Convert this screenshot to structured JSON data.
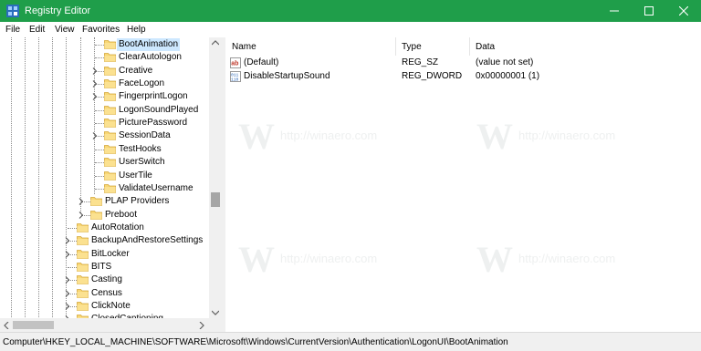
{
  "window": {
    "title": "Registry Editor",
    "accent": "#1f9e4a",
    "controls": [
      "minimize-icon",
      "maximize-icon",
      "close-icon"
    ]
  },
  "menu": [
    "File",
    "Edit",
    "View",
    "Favorites",
    "Help"
  ],
  "tree": {
    "items": [
      {
        "label": "BootAnimation",
        "selected": true
      },
      {
        "label": "ClearAutologon"
      },
      {
        "label": "Creative",
        "expandable": true
      },
      {
        "label": "FaceLogon",
        "expandable": true
      },
      {
        "label": "FingerprintLogon",
        "expandable": true
      },
      {
        "label": "LogonSoundPlayed"
      },
      {
        "label": "PicturePassword"
      },
      {
        "label": "SessionData",
        "expandable": true
      },
      {
        "label": "TestHooks"
      },
      {
        "label": "UserSwitch"
      },
      {
        "label": "UserTile"
      },
      {
        "label": "ValidateUsername"
      },
      {
        "label": "PLAP Providers",
        "expandable": true
      },
      {
        "label": "Preboot",
        "expandable": true
      },
      {
        "label": "AutoRotation"
      },
      {
        "label": "BackupAndRestoreSettings",
        "expandable": true
      },
      {
        "label": "BitLocker",
        "expandable": true
      },
      {
        "label": "BITS"
      },
      {
        "label": "Casting",
        "expandable": true
      },
      {
        "label": "Census",
        "expandable": true
      },
      {
        "label": "ClickNote",
        "expandable": true
      },
      {
        "label": "ClosedCaptioning",
        "expandable": true
      }
    ]
  },
  "values_list": {
    "columns": [
      "Name",
      "Type",
      "Data"
    ],
    "rows": [
      {
        "name": "(Default)",
        "type": "REG_SZ",
        "data": "(value not set)",
        "icon": "string-value-icon"
      },
      {
        "name": "DisableStartupSound",
        "type": "REG_DWORD",
        "data": "0x00000001 (1)",
        "icon": "binary-value-icon"
      }
    ]
  },
  "watermark": {
    "text": "http://winaero.com",
    "logo": "W"
  },
  "status": {
    "path": "Computer\\HKEY_LOCAL_MACHINE\\SOFTWARE\\Microsoft\\Windows\\CurrentVersion\\Authentication\\LogonUI\\BootAnimation"
  }
}
